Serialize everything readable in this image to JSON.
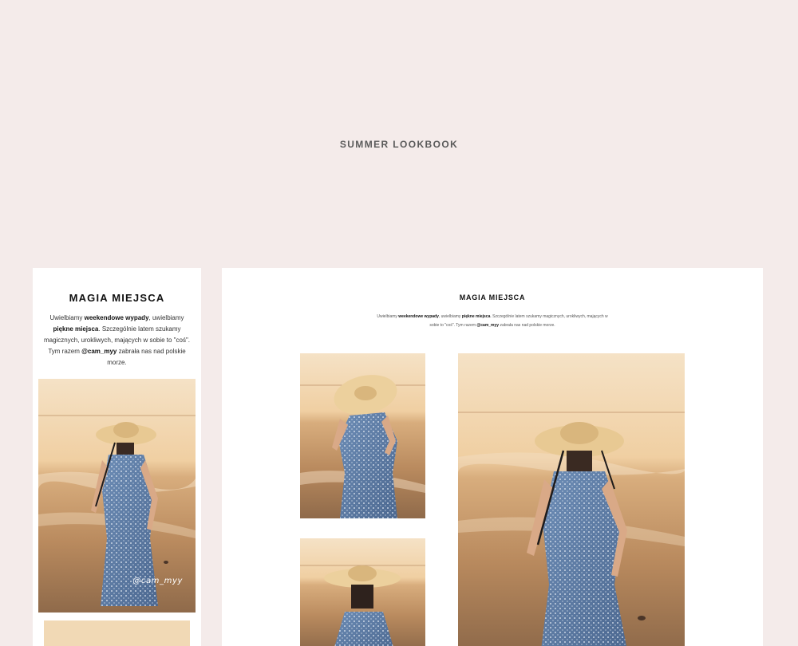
{
  "page": {
    "title": "SUMMER LOOKBOOK"
  },
  "mobile": {
    "heading": "MAGIA MIEJSCA",
    "text": {
      "p1": "Uwielbiamy ",
      "b1": "weekendowe wypady",
      "p2": ", uwielbiamy ",
      "b2": "piękne miejsca",
      "p3": ". Szczególnie latem szukamy magicznych, urokliwych, mających w sobie to \"coś\".  Tym razem ",
      "b3": "@cam_myy",
      "p4": " zabrała nas  nad polskie morze."
    },
    "photo_handle": "@cam_myy"
  },
  "desktop": {
    "heading": "MAGIA MIEJSCA",
    "text": {
      "p1": "Uwielbiamy ",
      "b1": "weekendowe wypady",
      "p2": ", uwielbiamy ",
      "b2": "piękne miejsca",
      "p3": ". Szczególnie latem szukamy magicznych, urokliwych, mających w sobie to \"coś\".  Tym razem ",
      "b3": "@cam_myy",
      "p4": " zabrała nas  nad polskie morze."
    }
  },
  "colors": {
    "background": "#f4ebea",
    "card": "#ffffff",
    "sky": "#f2d3ab",
    "sea": "#c79a68",
    "sand": "#9c7552",
    "dress": "#5f7fa8",
    "hat": "#e7c890"
  }
}
